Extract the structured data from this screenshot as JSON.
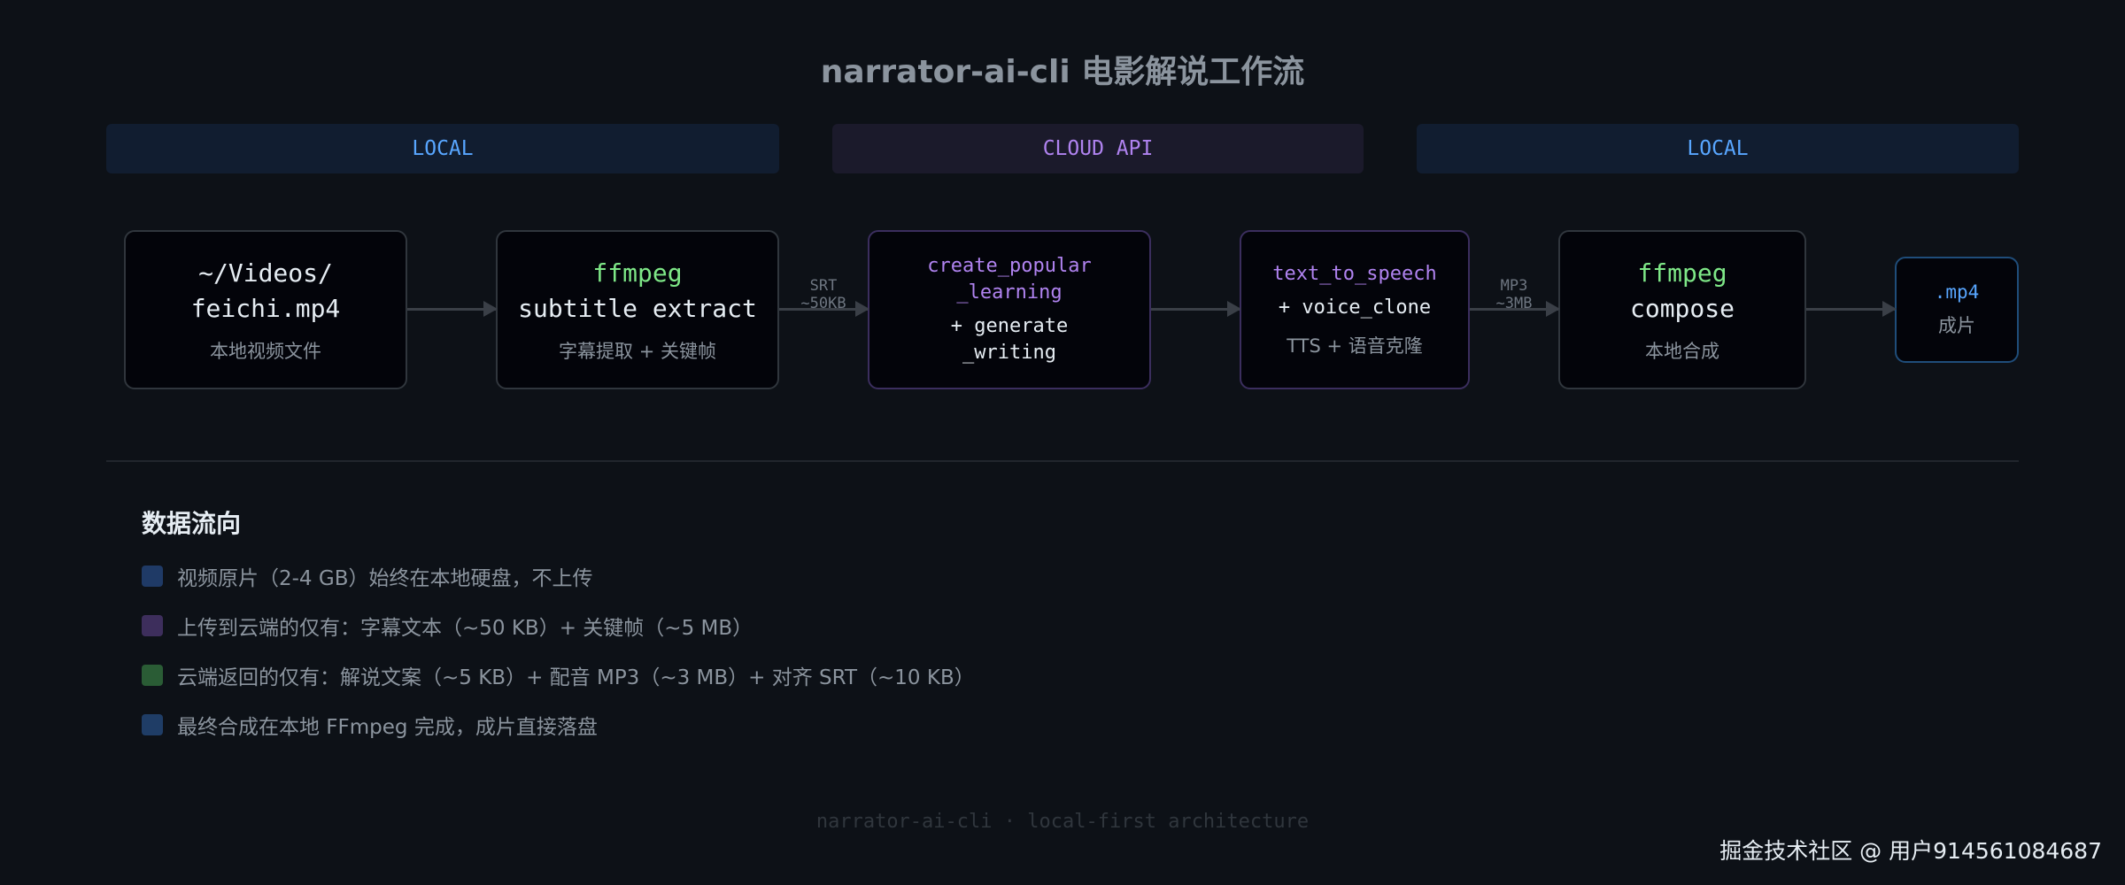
{
  "title": "narrator-ai-cli 电影解说工作流",
  "bands": [
    {
      "label": "LOCAL",
      "type": "local"
    },
    {
      "label": "CLOUD API",
      "type": "cloud"
    },
    {
      "label": "LOCAL",
      "type": "local"
    }
  ],
  "nodes": [
    {
      "line1": "~/Videos/",
      "line2": "feichi.mp4",
      "caption": "本地视频文件"
    },
    {
      "tool": "ffmpeg",
      "main": "subtitle extract",
      "caption": "字幕提取 + 关键帧"
    },
    {
      "line1": "create_popular",
      "line2": "_learning",
      "line3": "+ generate",
      "line4": "_writing"
    },
    {
      "line1": "text_to_speech",
      "line2": "+ voice_clone",
      "caption": "TTS + 语音克隆"
    },
    {
      "tool": "ffmpeg",
      "main": "compose",
      "caption": "本地合成"
    },
    {
      "main": ".mp4",
      "caption": "成片"
    }
  ],
  "edge_labels": [
    {
      "line1": "SRT",
      "line2": "~50KB"
    },
    {
      "line1": "MP3",
      "line2": "~3MB"
    }
  ],
  "legend": {
    "title": "数据流向",
    "items": [
      {
        "text": "视频原片（2-4 GB）始终在本地硬盘，不上传",
        "color": "#1f3a66"
      },
      {
        "text": "上传到云端的仅有：字幕文本（~50 KB）+ 关键帧（~5 MB）",
        "color": "#3d2e5c"
      },
      {
        "text": "云端返回的仅有：解说文案（~5 KB）+ 配音 MP3（~3 MB）+ 对齐 SRT（~10 KB）",
        "color": "#2a5c35"
      },
      {
        "text": "最终合成在本地 FFmpeg 完成，成片直接落盘",
        "color": "#1f3d66"
      }
    ]
  },
  "footer": "narrator-ai-cli · local-first architecture",
  "watermark": "掘金技术社区 @ 用户914561084687"
}
